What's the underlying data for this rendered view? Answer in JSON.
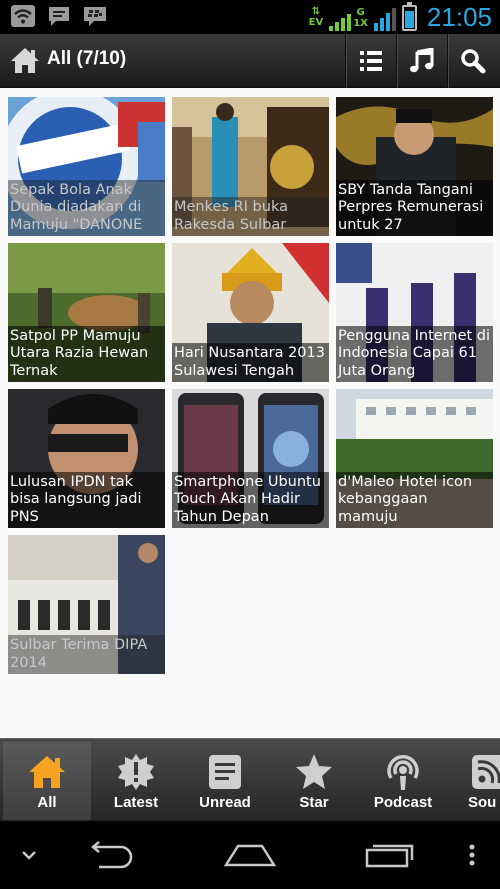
{
  "status_bar": {
    "network_type": "EV",
    "signal_left_label": "1X",
    "signal_right_label": "G",
    "clock": "21:05",
    "battery_level": 0.75,
    "accent_color": "#28a8e0",
    "icons": [
      "wifi-icon",
      "chat-icon",
      "bbm-icon"
    ]
  },
  "action_bar": {
    "title": "All (7/10)",
    "actions": [
      "list-icon",
      "music-icon",
      "search-icon"
    ]
  },
  "articles": [
    {
      "caption": "Sepak Bola Anak Dunia diadakan di Mamuju \"DANONE",
      "read": true
    },
    {
      "caption": "Menkes RI buka Rakesda Sulbar",
      "read": true
    },
    {
      "caption": "SBY Tanda Tangani Perpres Remunerasi untuk 27",
      "read": false
    },
    {
      "caption": "Satpol PP Mamuju Utara Razia Hewan Ternak",
      "read": false
    },
    {
      "caption": "Hari Nusantara 2013 Sulawesi Tengah",
      "read": false
    },
    {
      "caption": "Pengguna Internet di Indonesia Capai 61 Juta Orang",
      "read": false
    },
    {
      "caption": "Lulusan IPDN tak bisa langsung jadi PNS",
      "read": false
    },
    {
      "caption": "Smartphone Ubuntu Touch Akan Hadir Tahun Depan",
      "read": false
    },
    {
      "caption": "d'Maleo Hotel icon kebanggaan mamuju",
      "read": false
    },
    {
      "caption": "Sulbar Terima DIPA 2014",
      "read": true
    }
  ],
  "tabs": [
    {
      "label": "All",
      "icon": "home-icon",
      "active": true
    },
    {
      "label": "Latest",
      "icon": "burst-icon",
      "active": false
    },
    {
      "label": "Unread",
      "icon": "document-icon",
      "active": false
    },
    {
      "label": "Star",
      "icon": "star-icon",
      "active": false
    },
    {
      "label": "Podcast",
      "icon": "podcast-icon",
      "active": false
    },
    {
      "label": "Sou",
      "icon": "source-icon",
      "active": false
    }
  ],
  "nav_bar": [
    "hide-keyboard-icon",
    "back-icon",
    "home-icon",
    "recent-apps-icon",
    "overflow-icon"
  ],
  "colors": {
    "tab_active_icon": "#f6a321",
    "icon_gray": "#cfcfcf"
  }
}
